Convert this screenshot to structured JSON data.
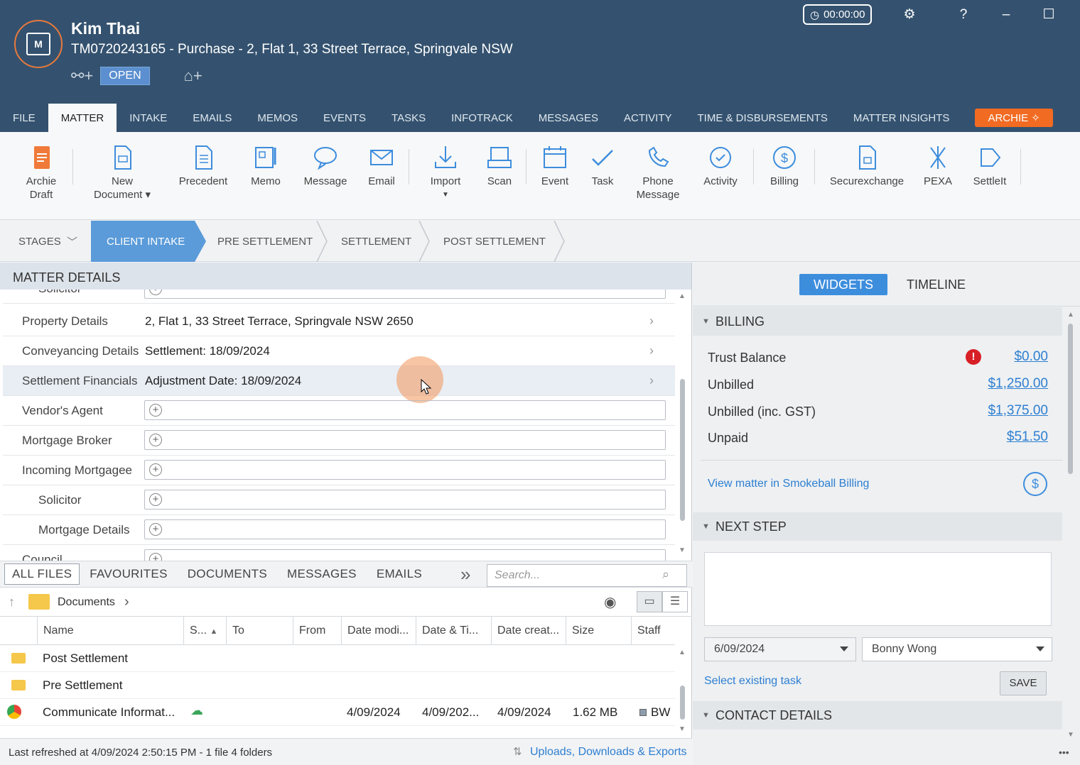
{
  "header": {
    "client_name": "Kim Thai",
    "matter_title": "TM0720243165 - Purchase - 2, Flat 1, 33 Street Terrace, Springvale NSW",
    "status_badge": "OPEN",
    "timer": "00:00:00",
    "help": "?",
    "minimize": "–",
    "maximize": "☐",
    "close": "✕"
  },
  "tabs": [
    "FILE",
    "MATTER",
    "INTAKE",
    "EMAILS",
    "MEMOS",
    "EVENTS",
    "TASKS",
    "INFOTRACK",
    "MESSAGES",
    "ACTIVITY",
    "TIME & DISBURSEMENTS",
    "MATTER INSIGHTS"
  ],
  "archie_tab": "ARCHIE",
  "ribbon": {
    "archie_draft": [
      "Archie",
      "Draft"
    ],
    "new_document": [
      "New",
      "Document ▾"
    ],
    "precedent": "Precedent",
    "memo": "Memo",
    "message": "Message",
    "email": "Email",
    "import": "Import",
    "scan": "Scan",
    "event": "Event",
    "task": "Task",
    "phone_message": [
      "Phone",
      "Message"
    ],
    "activity": "Activity",
    "billing": "Billing",
    "securexchange": "Securexchange",
    "pexa": "PEXA",
    "settleit": "SettleIt"
  },
  "stages": {
    "label": "STAGES",
    "items": [
      "CLIENT INTAKE",
      "PRE SETTLEMENT",
      "SETTLEMENT",
      "POST SETTLEMENT"
    ]
  },
  "matter_details": {
    "title": "MATTER DETAILS",
    "rows": [
      {
        "label": "Solicitor",
        "value": ""
      },
      {
        "label": "Property Details",
        "value": "2, Flat 1, 33 Street Terrace, Springvale NSW 2650"
      },
      {
        "label": "Conveyancing Details",
        "value": "Settlement: 18/09/2024"
      },
      {
        "label": "Settlement Financials",
        "value": "Adjustment Date: 18/09/2024"
      },
      {
        "label": "Vendor's Agent",
        "value": ""
      },
      {
        "label": "Mortgage Broker",
        "value": ""
      },
      {
        "label": "Incoming Mortgagee",
        "value": ""
      },
      {
        "label": "Solicitor",
        "value": ""
      },
      {
        "label": "Mortgage Details",
        "value": ""
      },
      {
        "label": "Council",
        "value": ""
      }
    ]
  },
  "files": {
    "tabs": [
      "ALL FILES",
      "FAVOURITES",
      "DOCUMENTS",
      "MESSAGES",
      "EMAILS"
    ],
    "more": "»",
    "search_placeholder": "Search...",
    "breadcrumb": "Documents",
    "columns": [
      "Name",
      "S...",
      "To",
      "From",
      "Date modi...",
      "Date & Ti...",
      "Date creat...",
      "Size",
      "Staff"
    ],
    "rows": [
      {
        "name": "Post Settlement",
        "type": "folder"
      },
      {
        "name": "Pre Settlement",
        "type": "folder"
      },
      {
        "name": "Communicate Informat...",
        "type": "chrome",
        "date_modified": "4/09/2024",
        "date_time": "4/09/202...",
        "date_created": "4/09/2024",
        "size": "1.62 MB",
        "staff": "BW"
      }
    ],
    "status_text": "Last refreshed at 4/09/2024 2:50:15 PM  -  1 file  4 folders",
    "uploads_link": "Uploads, Downloads & Exports"
  },
  "right": {
    "tabs": [
      "WIDGETS",
      "TIMELINE"
    ],
    "billing": {
      "title": "BILLING",
      "rows": [
        {
          "label": "Trust Balance",
          "value": "$0.00"
        },
        {
          "label": "Unbilled",
          "value": "$1,250.00"
        },
        {
          "label": "Unbilled (inc. GST)",
          "value": "$1,375.00"
        },
        {
          "label": "Unpaid",
          "value": "$51.50"
        }
      ],
      "link": "View matter in Smokeball Billing"
    },
    "next_step": {
      "title": "NEXT STEP",
      "date": "6/09/2024",
      "staff": "Bonny Wong",
      "select_task": "Select existing task",
      "save": "SAVE"
    },
    "contact_details": "CONTACT DETAILS"
  },
  "colors": {
    "header_bg": "#34526f",
    "accent": "#3d8ddd",
    "archie": "#f26b22",
    "alert": "#d81f26"
  }
}
